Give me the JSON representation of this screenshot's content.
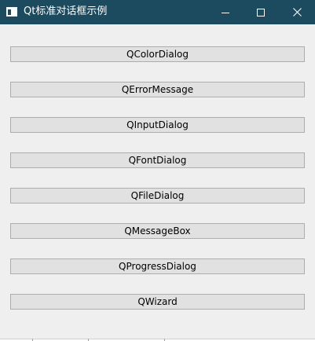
{
  "window": {
    "title": "Qt标准对话框示例",
    "controls": {
      "minimize_icon": "minimize-icon",
      "maximize_icon": "maximize-icon",
      "close_icon": "close-icon"
    }
  },
  "buttons": [
    {
      "label": "QColorDialog"
    },
    {
      "label": "QErrorMessage"
    },
    {
      "label": "QInputDialog"
    },
    {
      "label": "QFontDialog"
    },
    {
      "label": "QFileDialog"
    },
    {
      "label": "QMessageBox"
    },
    {
      "label": "QProgressDialog"
    },
    {
      "label": "QWizard"
    }
  ],
  "colors": {
    "titlebar": "#1c4a5e",
    "window_bg": "#f0eff0",
    "button_bg": "#e1e1e1",
    "button_border": "#adadad"
  }
}
